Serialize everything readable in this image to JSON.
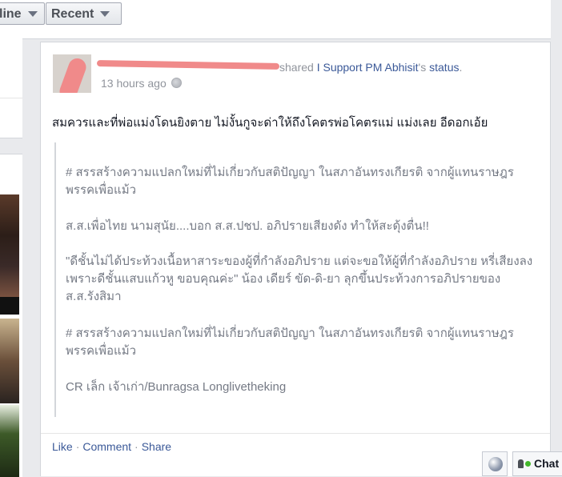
{
  "toolbar": {
    "online_label": "line",
    "recent_label": "Recent"
  },
  "post": {
    "shared_prefix": "shared",
    "shared_source": "I Support PM Abhisit",
    "shared_suffix": "'s",
    "shared_object": "status",
    "shared_end": ".",
    "timestamp": "13 hours ago",
    "text": "สมควรและที่พ่อแม่งโดนยิงตาย ไม่งั้นกูจะด่าให้ถึงโคตรพ่อโคตรแม่ แม่งเลย อีดอกเอ้ย",
    "quote": [
      "# สรรสร้างความแปลกใหม่ที่ไม่เกี่ยวกับสติปัญญา ในสภาอันทรงเกียรติ จากผู้แทนราษฎร พรรคเพื่อแม้ว",
      "ส.ส.เพื่อไทย นามสุนัย....บอก ส.ส.ปชป. อภิปรายเสียงดัง ทำให้สะดุ้งตื่น!!",
      "\"ดีชั้นไม่ได้ประท้วงเนื้อหาสาระของผู้ที่กำลังอภิปราย แต่จะขอให้ผู้ที่กำลังอภิปราย หรี่เสียงลง เพราะดีชั้นแสบแก้วหู ขอบคุณค่ะ\" น้อง เดียร์ ขัด-ดิ-ยา ลุกขึ้นประท้วงการอภิปรายของ ส.ส.รังสิมา",
      "# สรรสร้างความแปลกใหม่ที่ไม่เกี่ยวกับสติปัญญา ในสภาอันทรงเกียรติ จากผู้แทนราษฎร พรรคเพื่อแม้ว",
      "CR เล็ก เจ้าเก่า/Bunragsa Longlivetheking"
    ],
    "actions": {
      "like": "Like",
      "comment": "Comment",
      "share": "Share",
      "separator": "·"
    }
  },
  "chat": {
    "label": "Chat"
  },
  "icons": {
    "privacy": "globe-icon",
    "caret": "chevron-down-icon",
    "online_indicator": "green-dot-icon"
  },
  "colors": {
    "link": "#3b5998",
    "meta": "#90949c",
    "quote_text": "#757a85",
    "online": "#42b72a"
  }
}
